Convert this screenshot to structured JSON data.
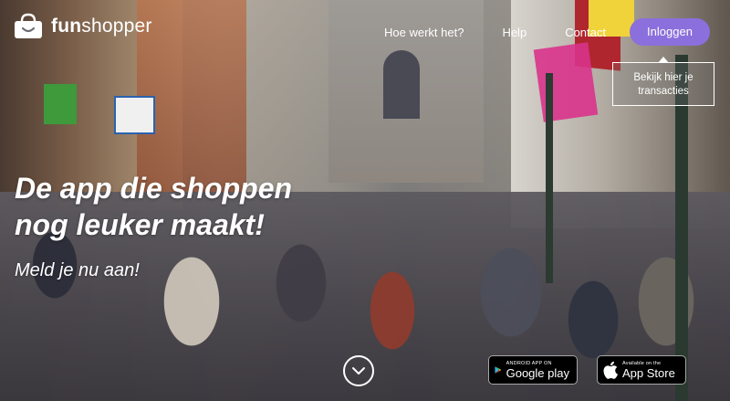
{
  "brand": {
    "name_prefix": "fun",
    "name_suffix": "shopper"
  },
  "nav": {
    "links": [
      {
        "label": "Hoe werkt het?"
      },
      {
        "label": "Help"
      },
      {
        "label": "Contact"
      }
    ],
    "login_label": "Inloggen",
    "tooltip_line1": "Bekijk hier je",
    "tooltip_line2": "transacties"
  },
  "hero": {
    "headline_line1": "De app die shoppen",
    "headline_line2": "nog leuker maakt!",
    "subline": "Meld je nu aan!",
    "scroll_icon": "chevron-down-icon"
  },
  "stores": {
    "google": {
      "small": "ANDROID APP ON",
      "big": "Google play",
      "icon": "google-play-icon"
    },
    "apple": {
      "small": "Available on the",
      "big": "App Store",
      "icon": "apple-icon"
    }
  },
  "colors": {
    "accent": "#8b6fdc",
    "text": "#ffffff",
    "badge_bg": "#000000"
  }
}
